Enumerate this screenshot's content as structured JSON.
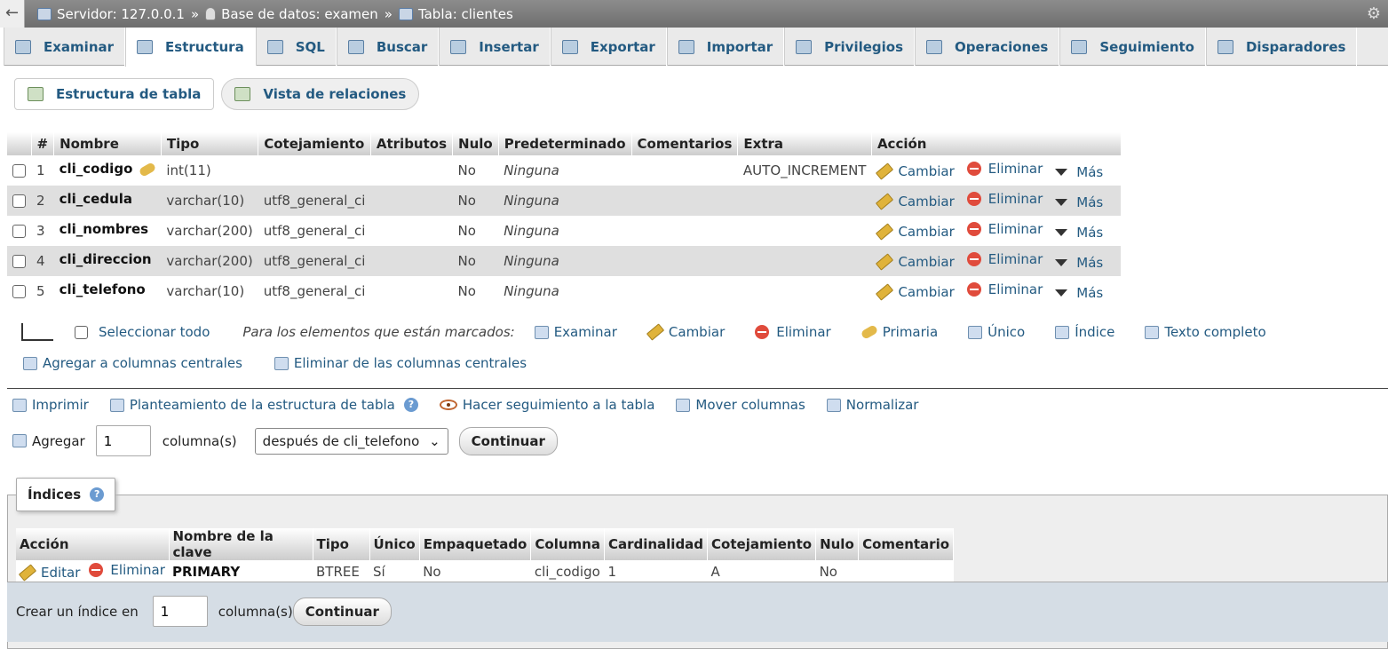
{
  "breadcrumb": {
    "server": "Servidor: 127.0.0.1",
    "sep": "»",
    "database": "Base de datos: examen",
    "table": "Tabla: clientes"
  },
  "tabs": [
    {
      "label": "Examinar",
      "icon": "browse-icon"
    },
    {
      "label": "Estructura",
      "icon": "structure-icon",
      "active": true
    },
    {
      "label": "SQL",
      "icon": "sql-icon"
    },
    {
      "label": "Buscar",
      "icon": "search-icon"
    },
    {
      "label": "Insertar",
      "icon": "insert-icon"
    },
    {
      "label": "Exportar",
      "icon": "export-icon"
    },
    {
      "label": "Importar",
      "icon": "import-icon"
    },
    {
      "label": "Privilegios",
      "icon": "privileges-icon"
    },
    {
      "label": "Operaciones",
      "icon": "operations-icon"
    },
    {
      "label": "Seguimiento",
      "icon": "tracking-icon"
    },
    {
      "label": "Disparadores",
      "icon": "triggers-icon"
    }
  ],
  "subnav": {
    "structure": "Estructura de tabla",
    "relations": "Vista de relaciones"
  },
  "structure": {
    "headers": [
      "#",
      "Nombre",
      "Tipo",
      "Cotejamiento",
      "Atributos",
      "Nulo",
      "Predeterminado",
      "Comentarios",
      "Extra",
      "Acción"
    ],
    "rows": [
      {
        "num": "1",
        "name": "cli_codigo",
        "type": "int(11)",
        "collation": "",
        "attributes": "",
        "null": "No",
        "default": "Ninguna",
        "comments": "",
        "extra": "AUTO_INCREMENT",
        "primary": true
      },
      {
        "num": "2",
        "name": "cli_cedula",
        "type": "varchar(10)",
        "collation": "utf8_general_ci",
        "attributes": "",
        "null": "No",
        "default": "Ninguna",
        "comments": "",
        "extra": ""
      },
      {
        "num": "3",
        "name": "cli_nombres",
        "type": "varchar(200)",
        "collation": "utf8_general_ci",
        "attributes": "",
        "null": "No",
        "default": "Ninguna",
        "comments": "",
        "extra": ""
      },
      {
        "num": "4",
        "name": "cli_direccion",
        "type": "varchar(200)",
        "collation": "utf8_general_ci",
        "attributes": "",
        "null": "No",
        "default": "Ninguna",
        "comments": "",
        "extra": ""
      },
      {
        "num": "5",
        "name": "cli_telefono",
        "type": "varchar(10)",
        "collation": "utf8_general_ci",
        "attributes": "",
        "null": "No",
        "default": "Ninguna",
        "comments": "",
        "extra": ""
      }
    ],
    "actions": {
      "change": "Cambiar",
      "drop": "Eliminar",
      "more": "Más"
    }
  },
  "bulk": {
    "select_all": "Seleccionar todo",
    "hint": "Para los elementos que están marcados:",
    "actions": [
      "Examinar",
      "Cambiar",
      "Eliminar",
      "Primaria",
      "Único",
      "Índice",
      "Texto completo"
    ],
    "add_central": "Agregar a columnas centrales",
    "remove_central": "Eliminar de las columnas centrales"
  },
  "tools": {
    "print": "Imprimir",
    "propose": "Planteamiento de la estructura de tabla",
    "track": "Hacer seguimiento a la tabla",
    "move": "Mover columnas",
    "normalize": "Normalizar"
  },
  "add_columns": {
    "label": "Agregar",
    "value": "1",
    "unit": "columna(s)",
    "position": "después de cli_telefono",
    "button": "Continuar"
  },
  "indexes": {
    "title": "Índices",
    "headers": [
      "Acción",
      "Nombre de la clave",
      "Tipo",
      "Único",
      "Empaquetado",
      "Columna",
      "Cardinalidad",
      "Cotejamiento",
      "Nulo",
      "Comentario"
    ],
    "row": {
      "edit": "Editar",
      "drop": "Eliminar",
      "key": "PRIMARY",
      "type": "BTREE",
      "unique": "Sí",
      "packed": "No",
      "column": "cli_codigo",
      "cardinality": "1",
      "collation": "A",
      "null": "No",
      "comment": ""
    },
    "create": {
      "label": "Crear un índice en",
      "value": "1",
      "unit": "columna(s)",
      "button": "Continuar"
    }
  }
}
